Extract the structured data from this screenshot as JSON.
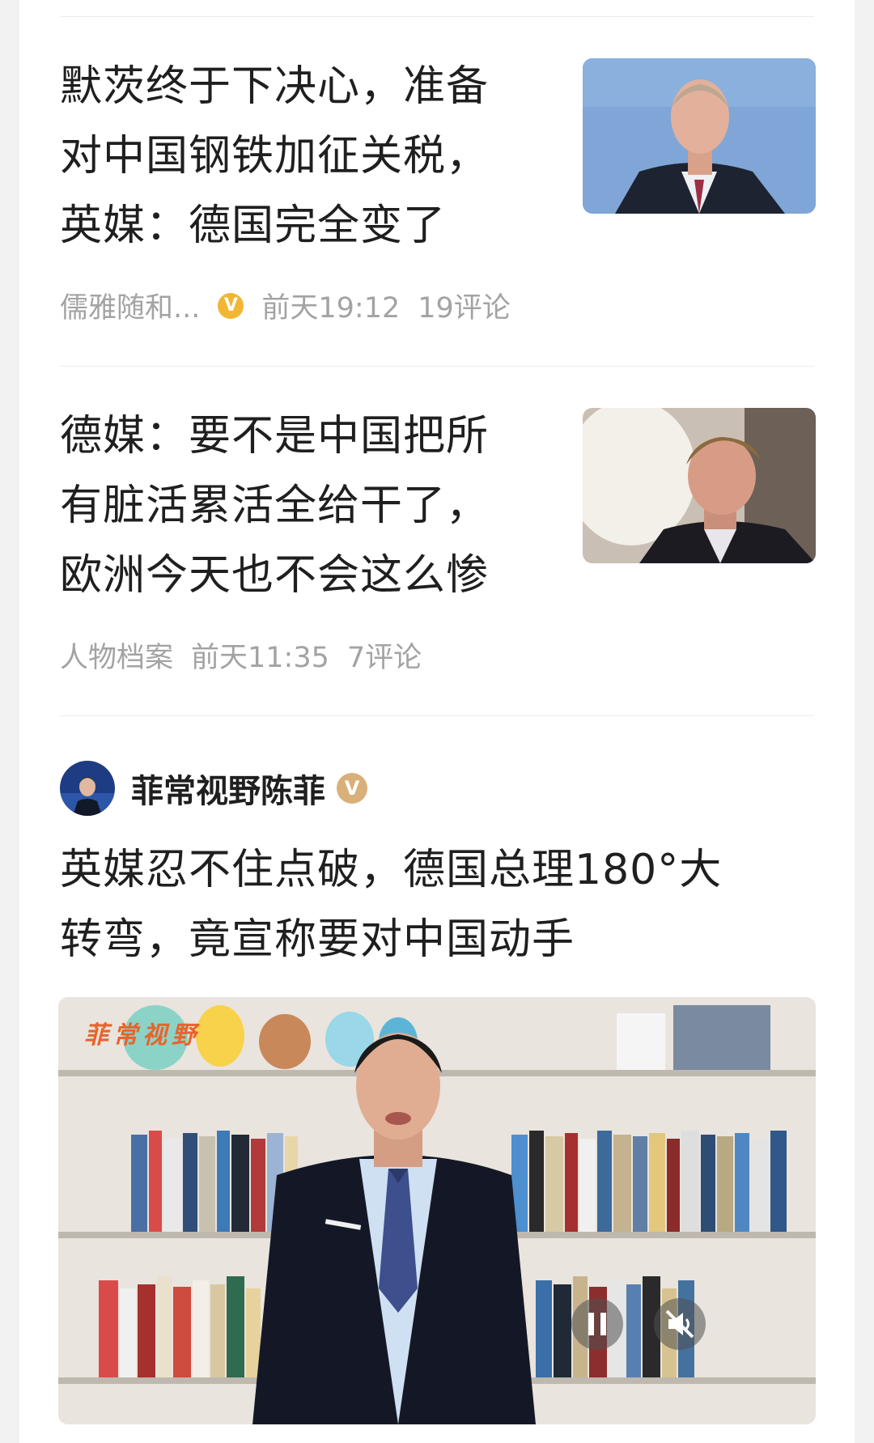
{
  "articles": [
    {
      "title_lines": [
        "默茨终于下决心，准备",
        "对中国钢铁加征关税，",
        "英媒：德国完全变了"
      ],
      "author": "儒雅随和...",
      "verified_badge": "V",
      "time": "前天19:12",
      "comments": "19评论",
      "thumbnail": "man-in-suit-blue-background"
    },
    {
      "title_lines": [
        "德媒：要不是中国把所",
        "有脏活累活全给干了，",
        "欧洲今天也不会这么惨"
      ],
      "author": "人物档案",
      "time": "前天11:35",
      "comments": "7评论",
      "thumbnail": "older-man-speaking"
    }
  ],
  "video_post": {
    "author": "菲常视野陈菲",
    "verified_badge": "V",
    "title_lines": [
      "英媒忍不住点破，德国总理180°大",
      "转弯，竟宣称要对中国动手"
    ],
    "watermark": "菲常视野",
    "controls": {
      "pause": "pause-icon",
      "mute": "mute-icon"
    }
  },
  "colors": {
    "badge_gold": "#f2b632",
    "author_badge": "#d8b079",
    "text": "#1f1f1f",
    "meta": "#a3a3a3"
  }
}
